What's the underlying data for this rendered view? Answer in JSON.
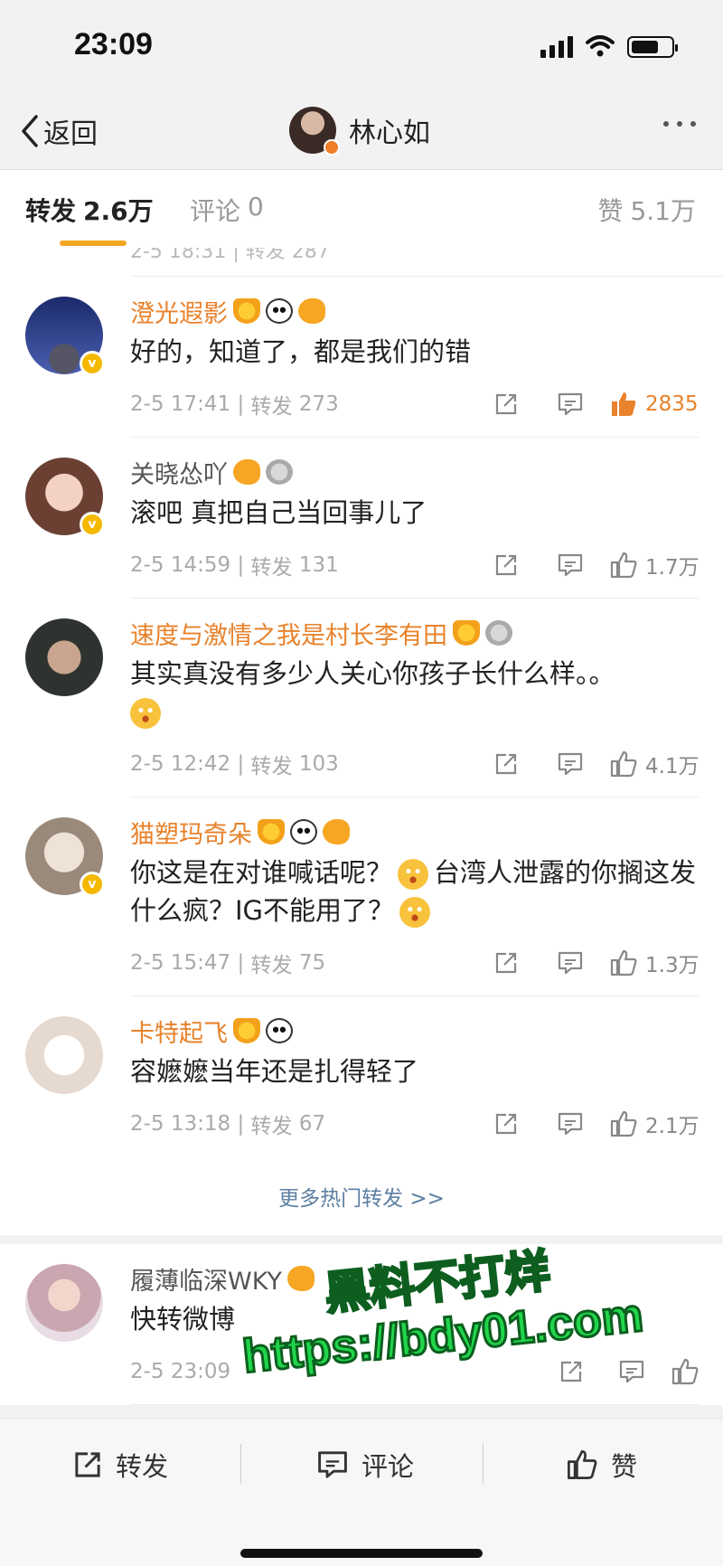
{
  "status_bar": {
    "time": "23:09"
  },
  "nav": {
    "back_label": "返回",
    "title": "林心如"
  },
  "tabs": {
    "forward_label": "转发",
    "forward_count": "2.6万",
    "comment_label": "评论",
    "comment_count": "0",
    "like_label": "赞",
    "like_count": "5.1万"
  },
  "partial_row": {
    "meta": "2-5 18:31 | 转发 287"
  },
  "items": [
    {
      "name": "澄光遐影",
      "name_color": "orange",
      "text": "好的，知道了，都是我们的错",
      "time": "2-5 17:41",
      "repost_label": "转发",
      "repost_count": "273",
      "likes": "2835",
      "liked": true
    },
    {
      "name": "关晓怂吖",
      "name_color": "gray",
      "text": "滚吧 真把自己当回事儿了",
      "time": "2-5 14:59",
      "repost_label": "转发",
      "repost_count": "131",
      "likes": "1.7万"
    },
    {
      "name": "速度与激情之我是村长李有田",
      "name_color": "orange",
      "text": "其实真没有多少人关心你孩子长什么样。。",
      "time": "2-5 12:42",
      "repost_label": "转发",
      "repost_count": "103",
      "likes": "4.1万"
    },
    {
      "name": "猫塑玛奇朵",
      "name_color": "orange",
      "text_part1": "你这是在对谁喊话呢？",
      "text_part2": "台湾人泄露的你搁这发什么疯？IG不能用了？",
      "time": "2-5 15:47",
      "repost_label": "转发",
      "repost_count": "75",
      "likes": "1.3万"
    },
    {
      "name": "卡特起飞",
      "name_color": "orange",
      "text": "容嬷嬷当年还是扎得轻了",
      "time": "2-5 13:18",
      "repost_label": "转发",
      "repost_count": "67",
      "likes": "2.1万"
    }
  ],
  "more_hot": "更多热门转发 >>",
  "latest": {
    "name": "履薄临深WKY",
    "text": "快转微博",
    "time": "2-5 23:09"
  },
  "watermark": {
    "line1": "黑料不打烊",
    "line2": "https://bdy01.com"
  },
  "bottom_bar": {
    "forward": "转发",
    "comment": "评论",
    "like": "赞"
  },
  "colors": {
    "accent_orange": "#e8822b",
    "tab_underline": "#f5a623",
    "link_blue": "#5c7fa3",
    "watermark_green": "#1fd64a"
  }
}
